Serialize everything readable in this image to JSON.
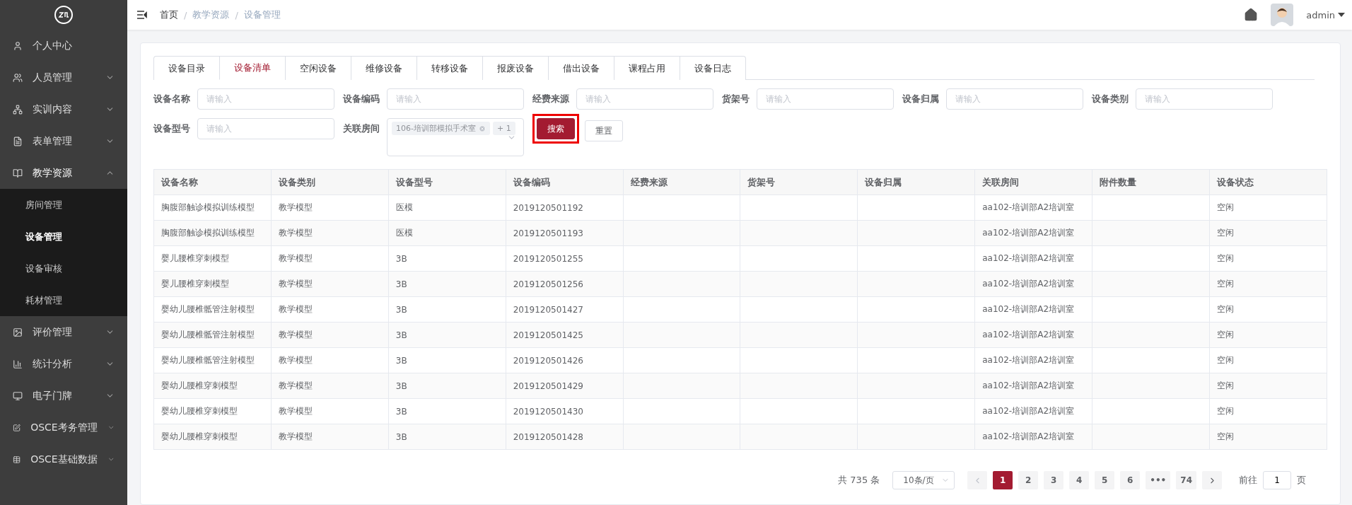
{
  "sidebar": {
    "items": [
      {
        "label": "个人中心",
        "kind": "link"
      },
      {
        "label": "人员管理",
        "kind": "group",
        "expanded": false
      },
      {
        "label": "实训内容",
        "kind": "group",
        "expanded": false
      },
      {
        "label": "表单管理",
        "kind": "group",
        "expanded": false
      },
      {
        "label": "教学资源",
        "kind": "group",
        "expanded": true,
        "children": [
          {
            "label": "房间管理",
            "selected": false
          },
          {
            "label": "设备管理",
            "selected": true
          },
          {
            "label": "设备审核",
            "selected": false
          },
          {
            "label": "耗材管理",
            "selected": false
          }
        ]
      },
      {
        "label": "评价管理",
        "kind": "group",
        "expanded": false
      },
      {
        "label": "统计分析",
        "kind": "group",
        "expanded": false
      },
      {
        "label": "电子门牌",
        "kind": "group",
        "expanded": false
      },
      {
        "label": "OSCE考务管理",
        "kind": "group",
        "expanded": false
      },
      {
        "label": "OSCE基础数据",
        "kind": "group",
        "expanded": false
      }
    ]
  },
  "breadcrumb": {
    "separator": "/",
    "items": [
      "首页",
      "教学资源",
      "设备管理"
    ]
  },
  "user": {
    "name": "admin"
  },
  "tabs": [
    {
      "label": "设备目录",
      "selected": false
    },
    {
      "label": "设备清单",
      "selected": true
    },
    {
      "label": "空闲设备",
      "selected": false
    },
    {
      "label": "维修设备",
      "selected": false
    },
    {
      "label": "转移设备",
      "selected": false
    },
    {
      "label": "报废设备",
      "selected": false
    },
    {
      "label": "借出设备",
      "selected": false
    },
    {
      "label": "课程占用",
      "selected": false
    },
    {
      "label": "设备日志",
      "selected": false
    }
  ],
  "filters": [
    {
      "label": "设备名称",
      "placeholder": "请输入"
    },
    {
      "label": "设备编码",
      "placeholder": "请输入"
    },
    {
      "label": "经费来源",
      "placeholder": "请输入"
    },
    {
      "label": "货架号",
      "placeholder": "请输入"
    },
    {
      "label": "设备归属",
      "placeholder": "请输入"
    },
    {
      "label": "设备类别",
      "placeholder": "请输入"
    },
    {
      "label": "设备型号",
      "placeholder": "请输入"
    }
  ],
  "room_select": {
    "label": "关联房间",
    "tags": [
      "106-培训部模拟手术室",
      "+ 1"
    ]
  },
  "search_button": {
    "label": "搜索",
    "highlighted": true
  },
  "reset_button": {
    "label": "重置"
  },
  "table": {
    "columns": [
      "设备名称",
      "设备类别",
      "设备型号",
      "设备编码",
      "经费来源",
      "货架号",
      "设备归属",
      "关联房间",
      "附件数量",
      "设备状态"
    ],
    "rows": [
      [
        "胸腹部触诊模拟训练模型",
        "教学模型",
        "医模",
        "2019120501192",
        "",
        "",
        "",
        "aa102-培训部A2培训室",
        "",
        "空闲"
      ],
      [
        "胸腹部触诊模拟训练模型",
        "教学模型",
        "医模",
        "2019120501193",
        "",
        "",
        "",
        "aa102-培训部A2培训室",
        "",
        "空闲"
      ],
      [
        "婴儿腰椎穿刺模型",
        "教学模型",
        "3B",
        "2019120501255",
        "",
        "",
        "",
        "aa102-培训部A2培训室",
        "",
        "空闲"
      ],
      [
        "婴儿腰椎穿刺模型",
        "教学模型",
        "3B",
        "2019120501256",
        "",
        "",
        "",
        "aa102-培训部A2培训室",
        "",
        "空闲"
      ],
      [
        "婴幼儿腰椎骶管注射模型",
        "教学模型",
        "3B",
        "2019120501427",
        "",
        "",
        "",
        "aa102-培训部A2培训室",
        "",
        "空闲"
      ],
      [
        "婴幼儿腰椎骶管注射模型",
        "教学模型",
        "3B",
        "2019120501425",
        "",
        "",
        "",
        "aa102-培训部A2培训室",
        "",
        "空闲"
      ],
      [
        "婴幼儿腰椎骶管注射模型",
        "教学模型",
        "3B",
        "2019120501426",
        "",
        "",
        "",
        "aa102-培训部A2培训室",
        "",
        "空闲"
      ],
      [
        "婴幼儿腰椎穿刺模型",
        "教学模型",
        "3B",
        "2019120501429",
        "",
        "",
        "",
        "aa102-培训部A2培训室",
        "",
        "空闲"
      ],
      [
        "婴幼儿腰椎穿刺模型",
        "教学模型",
        "3B",
        "2019120501430",
        "",
        "",
        "",
        "aa102-培训部A2培训室",
        "",
        "空闲"
      ],
      [
        "婴幼儿腰椎穿刺模型",
        "教学模型",
        "3B",
        "2019120501428",
        "",
        "",
        "",
        "aa102-培训部A2培训室",
        "",
        "空闲"
      ]
    ]
  },
  "pagination": {
    "total": "共 735 条",
    "page_size": "10条/页",
    "pages": [
      {
        "label": "1",
        "selected": true
      },
      {
        "label": "2",
        "selected": false
      },
      {
        "label": "3",
        "selected": false
      },
      {
        "label": "4",
        "selected": false
      },
      {
        "label": "5",
        "selected": false
      },
      {
        "label": "6",
        "selected": false
      },
      {
        "label": "•••",
        "selected": false
      },
      {
        "label": "74",
        "selected": false
      }
    ],
    "goto_label": "前往",
    "goto_value": "1",
    "page_unit": "页"
  }
}
